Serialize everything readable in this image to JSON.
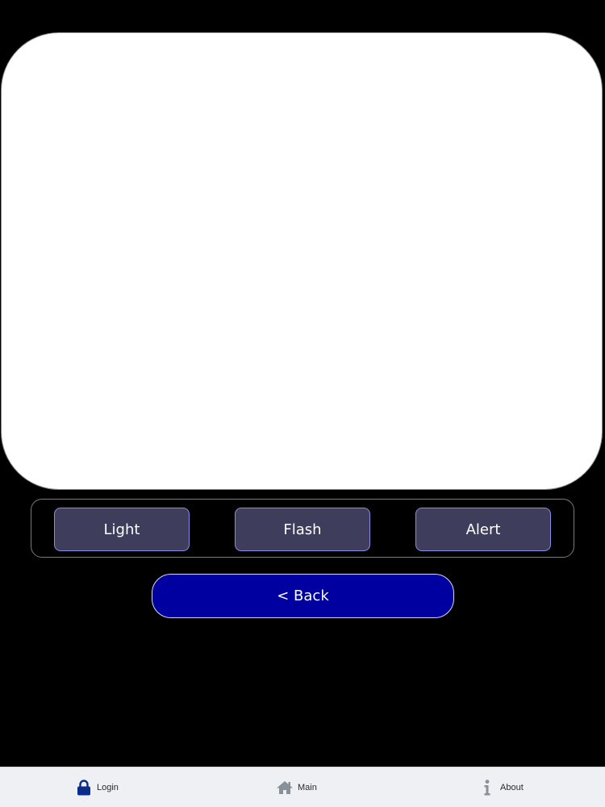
{
  "mode_buttons": {
    "light_label": "Light",
    "flash_label": "Flash",
    "alert_label": "Alert"
  },
  "back_label": "< Back",
  "tab_bar": {
    "login_label": "Login",
    "main_label": "Main",
    "about_label": "About",
    "login_icon": "lock-icon",
    "main_icon": "home-icon",
    "about_icon": "info-icon",
    "active_color": "#0b2d8a",
    "inactive_color": "#8a9099"
  },
  "colors": {
    "background": "#000000",
    "panel": "#ffffff",
    "mode_button": "#3e3e5c",
    "back_button": "#0000a0"
  }
}
